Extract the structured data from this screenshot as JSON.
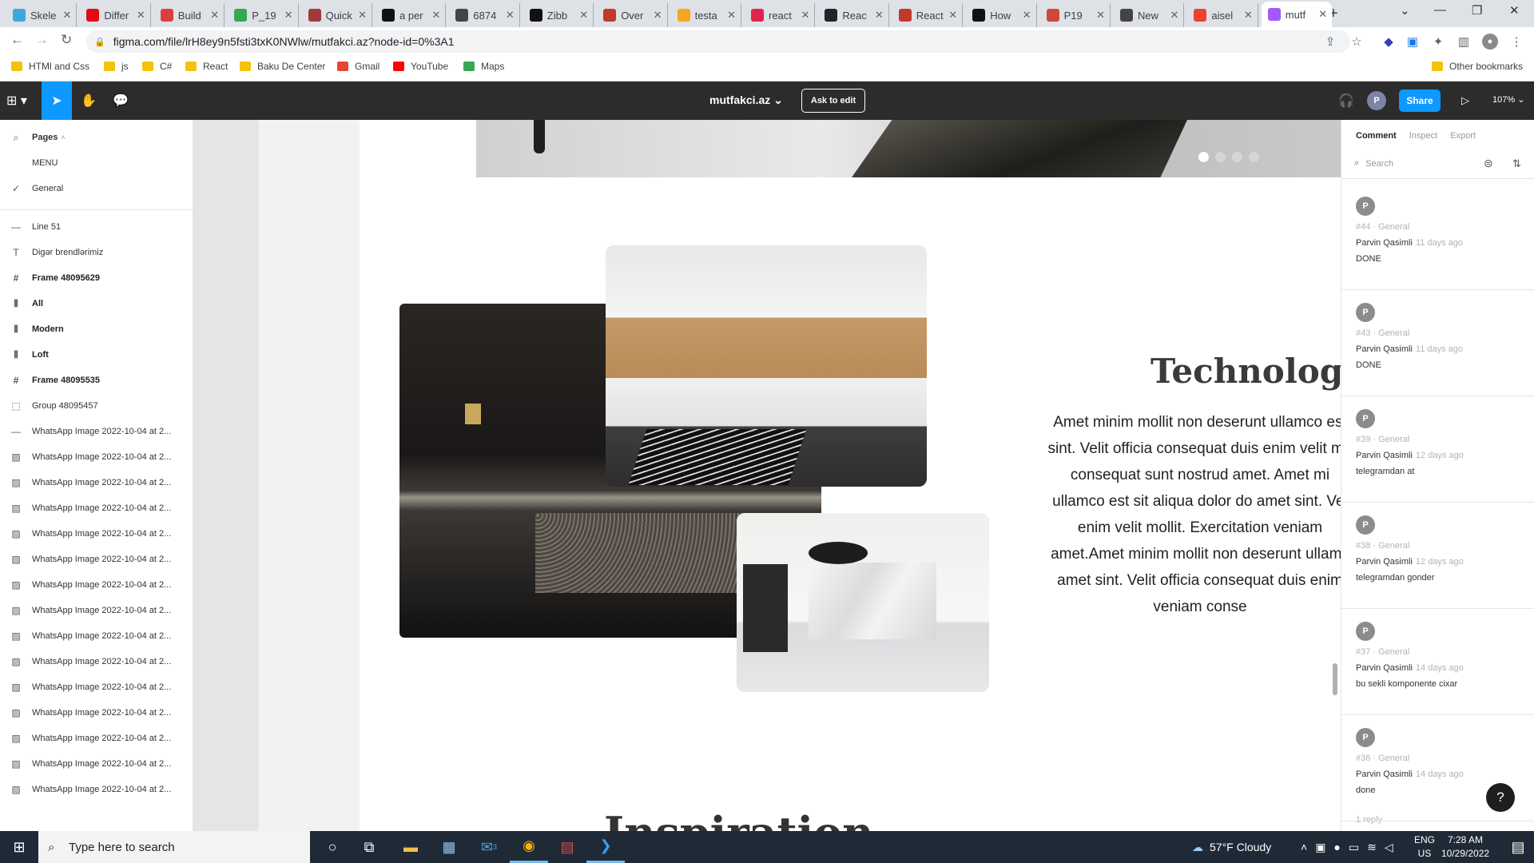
{
  "browser": {
    "tabs": [
      {
        "title": "Skele",
        "icon": "skeleton-icon",
        "color": "#3ea6dc"
      },
      {
        "title": "Differ",
        "icon": "netflix-icon",
        "color": "#e50914"
      },
      {
        "title": "Build",
        "icon": "build-icon",
        "color": "#d93f3f"
      },
      {
        "title": "P_19",
        "icon": "google-drive-icon",
        "color": "#34a853"
      },
      {
        "title": "Quick",
        "icon": "gear-icon",
        "color": "#a33a3a"
      },
      {
        "title": "a per",
        "icon": "person-icon",
        "color": "#111111"
      },
      {
        "title": "6874",
        "icon": "github-icon",
        "color": "#444444"
      },
      {
        "title": "Zibb",
        "icon": "z-icon",
        "color": "#111111"
      },
      {
        "title": "Over",
        "icon": "mountain-icon",
        "color": "#c0392b"
      },
      {
        "title": "testa",
        "icon": "flame-icon",
        "color": "#f5a623"
      },
      {
        "title": "react",
        "icon": "react-icon",
        "color": "#e0234e"
      },
      {
        "title": "Reac",
        "icon": "react-icon",
        "color": "#20232a"
      },
      {
        "title": "React",
        "icon": "mountain-icon",
        "color": "#c0392b"
      },
      {
        "title": "How",
        "icon": "medium-icon",
        "color": "#111111"
      },
      {
        "title": "P19",
        "icon": "document-icon",
        "color": "#d0463b"
      },
      {
        "title": "New",
        "icon": "github-icon",
        "color": "#444444"
      },
      {
        "title": "aisel",
        "icon": "gmail-icon",
        "color": "#ea4335"
      },
      {
        "title": "mutf",
        "icon": "figma-icon",
        "color": "#a259ff"
      }
    ],
    "url": "figma.com/file/lrH8ey9n5fsti3txK0NWlw/mutfakci.az?node-id=0%3A1",
    "bookmarks": [
      {
        "label": "HTMl and Css",
        "type": "folder"
      },
      {
        "label": "js",
        "type": "folder"
      },
      {
        "label": "C#",
        "type": "folder"
      },
      {
        "label": "React",
        "type": "folder"
      },
      {
        "label": "Baku De Center",
        "type": "folder"
      },
      {
        "label": "Gmail",
        "type": "gmail-icon"
      },
      {
        "label": "YouTube",
        "type": "youtube-icon"
      },
      {
        "label": "Maps",
        "type": "maps-icon"
      }
    ],
    "other_bookmarks": "Other bookmarks"
  },
  "figma": {
    "file_name": "mutfakci.az",
    "ask_to_edit": "Ask to edit",
    "avatar_letter": "P",
    "share": "Share",
    "zoom": "107%",
    "accent": "#0d99ff"
  },
  "left_panel": {
    "pages_label": "Pages",
    "pages": [
      {
        "label": "MENU",
        "checked": false
      },
      {
        "label": "General",
        "checked": true
      }
    ],
    "layers": [
      {
        "label": "Line 51",
        "icon": "line-icon",
        "bold": false
      },
      {
        "label": "Digər brendlərimiz",
        "icon": "text-icon",
        "bold": false
      },
      {
        "label": "Frame 48095629",
        "icon": "frame-icon",
        "bold": true
      },
      {
        "label": "All",
        "icon": "auto-layout-icon",
        "bold": true
      },
      {
        "label": "Modern",
        "icon": "auto-layout-icon",
        "bold": true
      },
      {
        "label": "Loft",
        "icon": "auto-layout-icon",
        "bold": true
      },
      {
        "label": "Frame 48095535",
        "icon": "frame-icon",
        "bold": true
      },
      {
        "label": "Group 48095457",
        "icon": "group-icon",
        "bold": false
      },
      {
        "label": "WhatsApp Image 2022-10-04 at 2...",
        "icon": "line-icon",
        "bold": false
      },
      {
        "label": "WhatsApp Image 2022-10-04 at 2...",
        "icon": "image-icon",
        "bold": false
      },
      {
        "label": "WhatsApp Image 2022-10-04 at 2...",
        "icon": "image-icon",
        "bold": false
      },
      {
        "label": "WhatsApp Image 2022-10-04 at 2...",
        "icon": "image-icon",
        "bold": false
      },
      {
        "label": "WhatsApp Image 2022-10-04 at 2...",
        "icon": "image-icon",
        "bold": false
      },
      {
        "label": "WhatsApp Image 2022-10-04 at 2...",
        "icon": "image-icon",
        "bold": false
      },
      {
        "label": "WhatsApp Image 2022-10-04 at 2...",
        "icon": "image-icon",
        "bold": false
      },
      {
        "label": "WhatsApp Image 2022-10-04 at 2...",
        "icon": "image-icon",
        "bold": false
      },
      {
        "label": "WhatsApp Image 2022-10-04 at 2...",
        "icon": "image-icon",
        "bold": false
      },
      {
        "label": "WhatsApp Image 2022-10-04 at 2...",
        "icon": "image-icon",
        "bold": false
      },
      {
        "label": "WhatsApp Image 2022-10-04 at 2...",
        "icon": "image-icon",
        "bold": false
      },
      {
        "label": "WhatsApp Image 2022-10-04 at 2...",
        "icon": "image-icon",
        "bold": false
      },
      {
        "label": "WhatsApp Image 2022-10-04 at 2...",
        "icon": "image-icon",
        "bold": false
      },
      {
        "label": "WhatsApp Image 2022-10-04 at 2...",
        "icon": "image-icon",
        "bold": false
      },
      {
        "label": "WhatsApp Image 2022-10-04 at 2...",
        "icon": "image-icon",
        "bold": false
      }
    ]
  },
  "canvas": {
    "carousel_dots": 4,
    "carousel_active": 1,
    "heading": "Technologie t",
    "paragraph_lines": [
      "Amet minim mollit non deserunt ullamco est",
      "sint. Velit officia consequat duis enim velit mo",
      "consequat sunt nostrud amet. Amet mi",
      "ullamco est sit aliqua dolor do amet sint. Vel",
      "enim velit mollit. Exercitation veniam",
      "amet.Amet minim mollit non deserunt ullamc",
      "amet sint. Velit officia consequat duis enim",
      "veniam conse"
    ],
    "bottom_heading": "Inspiration"
  },
  "right_panel": {
    "tabs": [
      "Comment",
      "Inspect",
      "Export"
    ],
    "active_tab": "Comment",
    "search_placeholder": "Search",
    "comments": [
      {
        "avatar": "P",
        "meta": "#44 · General",
        "author": "Parvin Qasimli",
        "time": "11 days ago",
        "text": "DONE"
      },
      {
        "avatar": "P",
        "meta": "#43 · General",
        "author": "Parvin Qasimli",
        "time": "11 days ago",
        "text": "DONE"
      },
      {
        "avatar": "P",
        "meta": "#39 · General",
        "author": "Parvin Qasimli",
        "time": "12 days ago",
        "text": "telegramdan at"
      },
      {
        "avatar": "P",
        "meta": "#38 · General",
        "author": "Parvin Qasimli",
        "time": "12 days ago",
        "text": "telegramdan gonder"
      },
      {
        "avatar": "P",
        "meta": "#37 · General",
        "author": "Parvin Qasimli",
        "time": "14 days ago",
        "text": "bu sekli komponente cixar"
      },
      {
        "avatar": "P",
        "meta": "#36 · General",
        "author": "Parvin Qasimli",
        "time": "14 days ago",
        "text": "done"
      }
    ],
    "reply_count": "1 reply",
    "help": "?"
  },
  "taskbar": {
    "search_placeholder": "Type here to search",
    "weather": "57°F  Cloudy",
    "language": "ENG",
    "region": "US",
    "time": "7:28 AM",
    "date": "10/29/2022",
    "mail_badge": "3"
  }
}
